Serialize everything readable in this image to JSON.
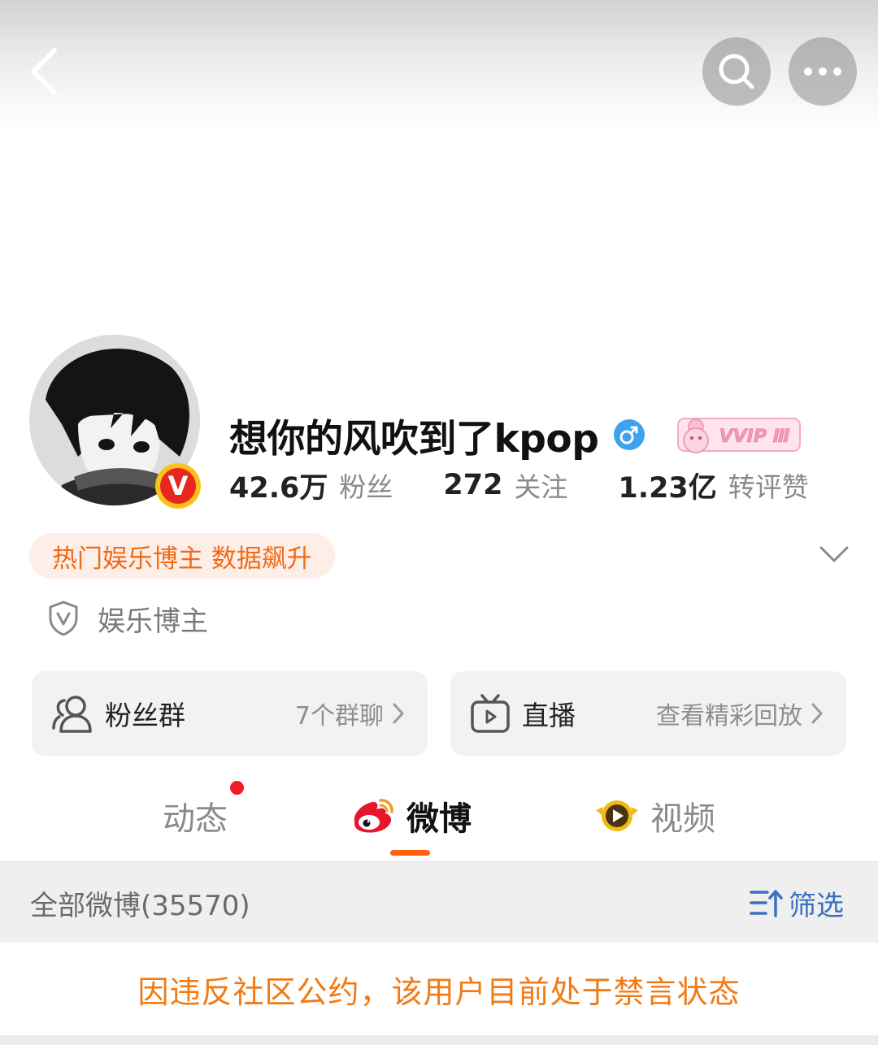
{
  "colors": {
    "accent_orange": "#ff5f0f",
    "ban_text": "#f27a14",
    "filter_blue": "#3b6fbf",
    "badge_red": "#e8261e",
    "badge_gold": "#f9c21a",
    "gender_blue": "#3ea3ef"
  },
  "header": {
    "back_icon": "chevron-left-icon",
    "search_icon": "search-icon",
    "more_icon": "more-dots-icon"
  },
  "profile": {
    "username": "想你的风吹到了kpop",
    "gender_icon": "male-icon",
    "vip_badge": "VVIP Ⅲ",
    "verified_badge": "V",
    "stats": [
      {
        "value": "42.6万",
        "label": "粉丝"
      },
      {
        "value": "272",
        "label": "关注"
      },
      {
        "value": "1.23亿",
        "label": "转评赞"
      }
    ],
    "hot_tag": "热门娱乐博主 数据飙升",
    "certification": "娱乐博主"
  },
  "cards": {
    "fans_group": {
      "title": "粉丝群",
      "sub": "7个群聊"
    },
    "live": {
      "title": "直播",
      "sub": "查看精彩回放"
    }
  },
  "tabs": [
    {
      "label": "动态",
      "active": false,
      "has_dot": true
    },
    {
      "label": "微博",
      "active": true
    },
    {
      "label": "视频",
      "active": false
    }
  ],
  "filter_bar": {
    "title": "全部微博(35570)",
    "filter_label": "筛选"
  },
  "ban_notice": "因违反社区公约，该用户目前处于禁言状态"
}
